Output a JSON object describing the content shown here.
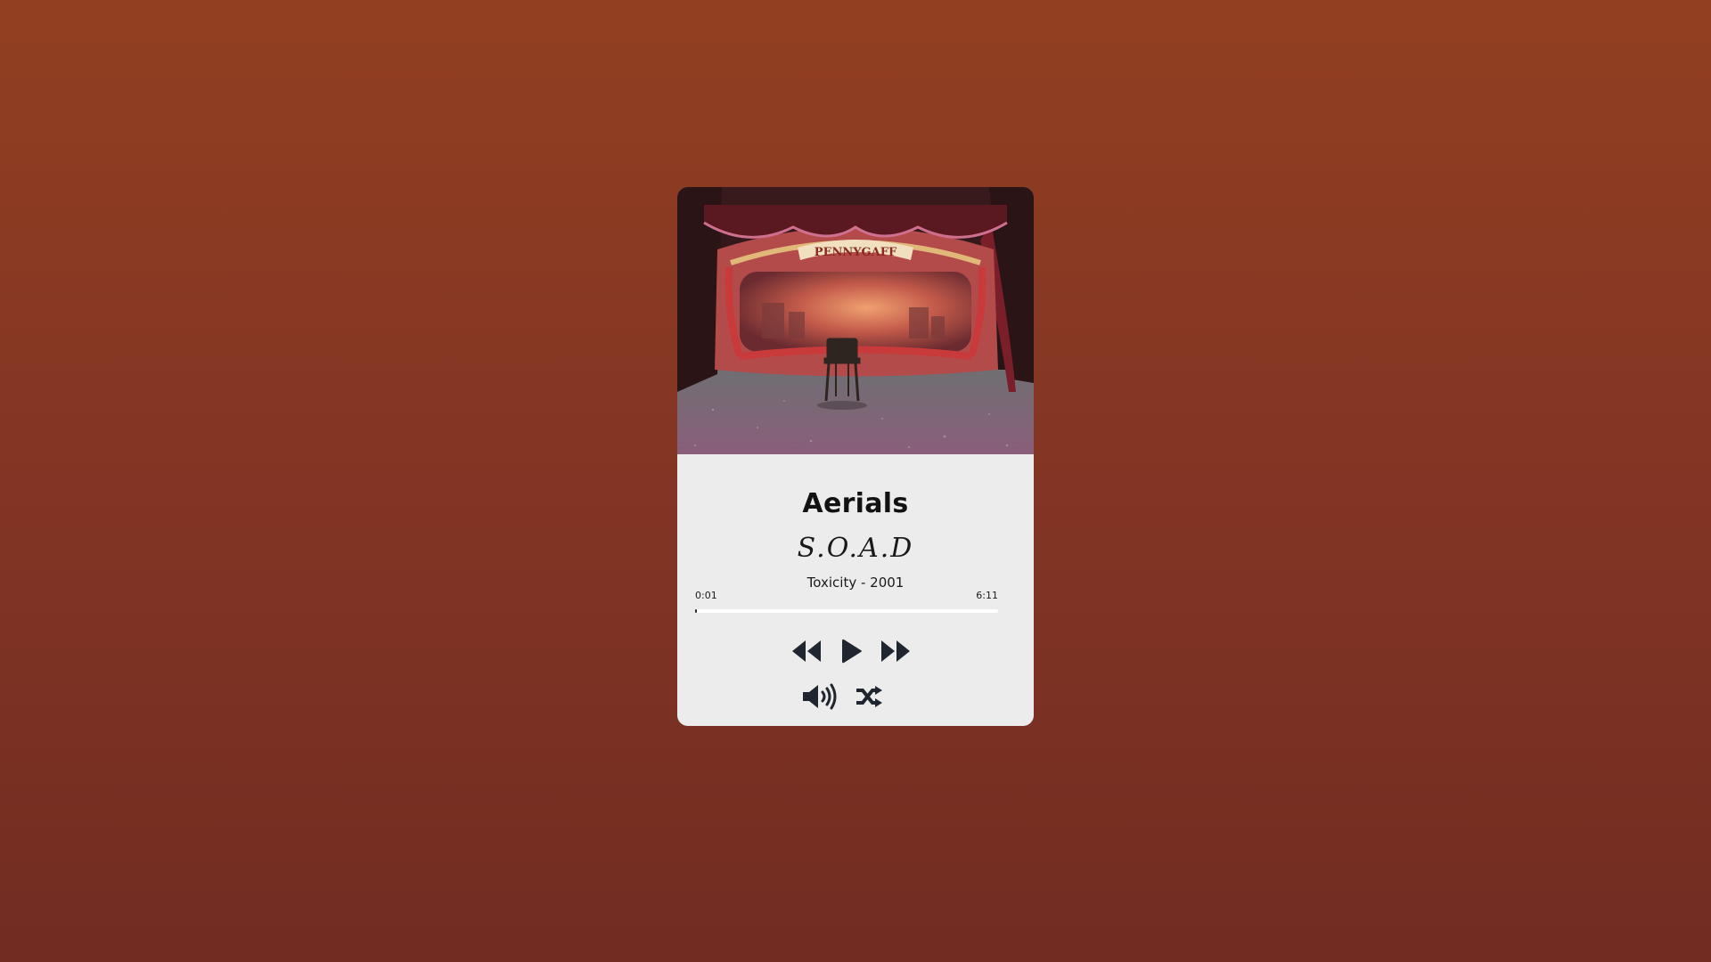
{
  "track": {
    "title": "Aerials",
    "artist": "S.O.A.D",
    "album_year": "Toxicity - 2001",
    "current_time": "0:01",
    "duration": "6:11",
    "progress": 0.003
  },
  "cover_art": {
    "description_icon": "theater-stage-image",
    "banner_text": "PENNYGAFF"
  },
  "controls": {
    "previous_icon": "rewind-icon",
    "play_icon": "play-icon",
    "next_icon": "fast-forward-icon",
    "volume_icon": "volume-icon",
    "shuffle_icon": "shuffle-icon"
  },
  "colors": {
    "background_top": "#923f21",
    "background_bottom": "#722c22",
    "card": "#ececec",
    "icon": "#1f2630"
  }
}
